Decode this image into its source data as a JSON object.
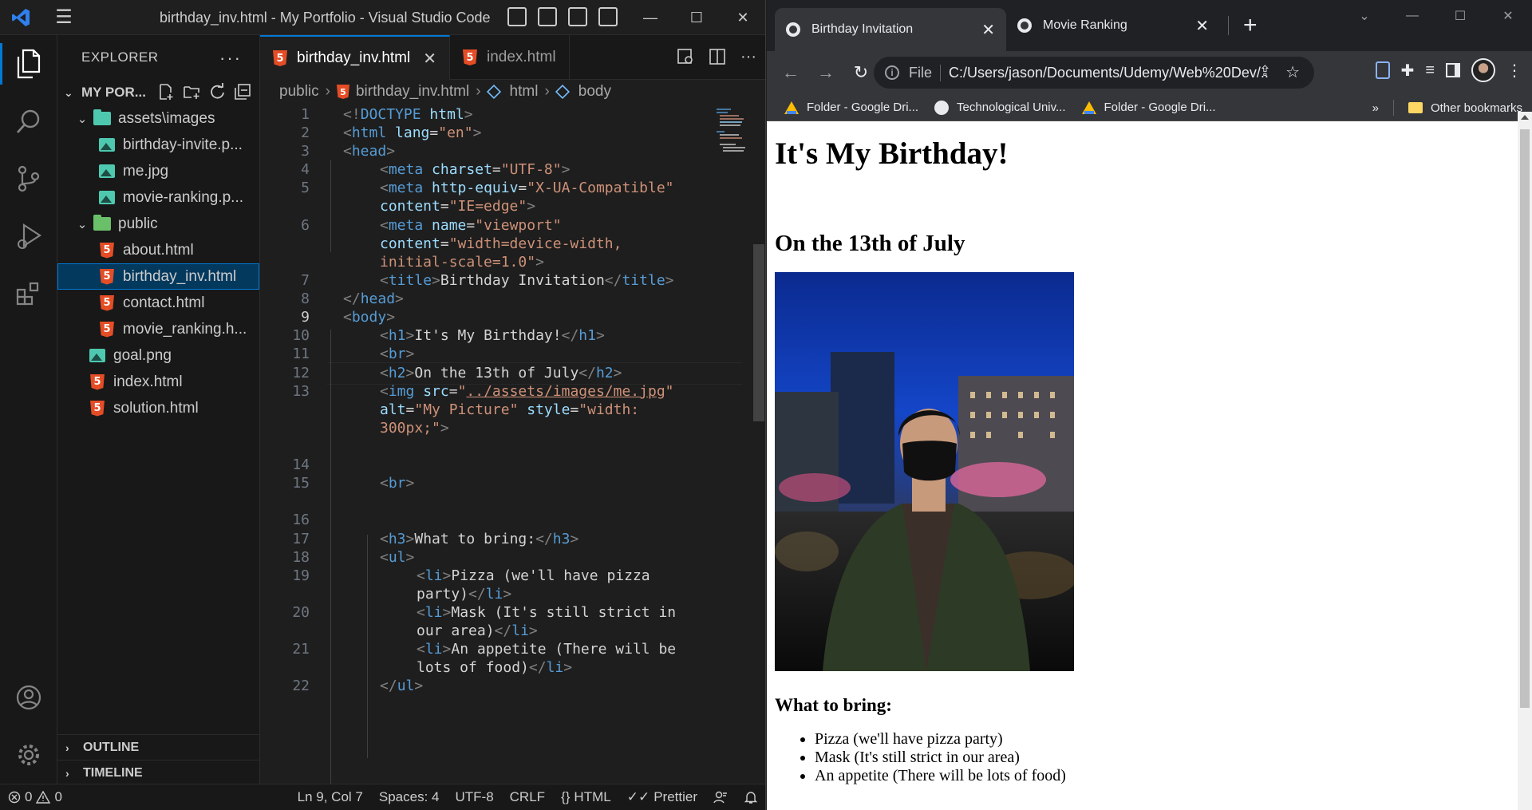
{
  "vscode": {
    "window_title": "birthday_inv.html - My Portfolio - Visual Studio Code",
    "explorer": {
      "header": "EXPLORER",
      "root_label": "MY POR...",
      "tree": [
        {
          "label": "assets\\images",
          "type": "folder"
        },
        {
          "label": "birthday-invite.p...",
          "type": "image"
        },
        {
          "label": "me.jpg",
          "type": "image"
        },
        {
          "label": "movie-ranking.p...",
          "type": "image"
        },
        {
          "label": "public",
          "type": "folder"
        },
        {
          "label": "about.html",
          "type": "html"
        },
        {
          "label": "birthday_inv.html",
          "type": "html",
          "selected": true
        },
        {
          "label": "contact.html",
          "type": "html"
        },
        {
          "label": "movie_ranking.h...",
          "type": "html"
        },
        {
          "label": "goal.png",
          "type": "image"
        },
        {
          "label": "index.html",
          "type": "html"
        },
        {
          "label": "solution.html",
          "type": "html"
        }
      ],
      "outline_label": "OUTLINE",
      "timeline_label": "TIMELINE"
    },
    "tabs": [
      {
        "label": "birthday_inv.html",
        "active": true
      },
      {
        "label": "index.html",
        "active": false
      }
    ],
    "breadcrumb": [
      "public",
      "birthday_inv.html",
      "html",
      "body"
    ],
    "line_numbers": [
      "1",
      "2",
      "3",
      "4",
      "5",
      "",
      "6",
      "",
      "",
      "7",
      "8",
      "9",
      "10",
      "11",
      "12",
      "13",
      "",
      "",
      "14",
      "15",
      "16",
      "17",
      "18",
      "19",
      "",
      "20",
      "",
      "21",
      "",
      "22"
    ],
    "current_line": "9",
    "statusbar": {
      "errors": "0",
      "warnings": "0",
      "position": "Ln 9, Col 7",
      "spaces": "Spaces: 4",
      "encoding": "UTF-8",
      "eol": "CRLF",
      "language": "HTML",
      "formatter": "Prettier"
    }
  },
  "chrome": {
    "tabs": [
      {
        "title": "Birthday Invitation",
        "active": true
      },
      {
        "title": "Movie Ranking",
        "active": false
      }
    ],
    "address_prefix": "File",
    "address": "C:/Users/jason/Documents/Udemy/Web%20Dev/...",
    "bookmarks": [
      "Folder - Google Dri...",
      "Technological Univ...",
      "Folder - Google Dri..."
    ],
    "bookmarks_overflow": "»",
    "other_bookmarks": "Other bookmarks",
    "page": {
      "h1": "It's My Birthday!",
      "h2": "On the 13th of July",
      "img_alt": "My Picture",
      "h3": "What to bring:",
      "items": [
        "Pizza (we'll have pizza party)",
        "Mask (It's still strict in our area)",
        "An appetite (There will be lots of food)"
      ]
    }
  }
}
